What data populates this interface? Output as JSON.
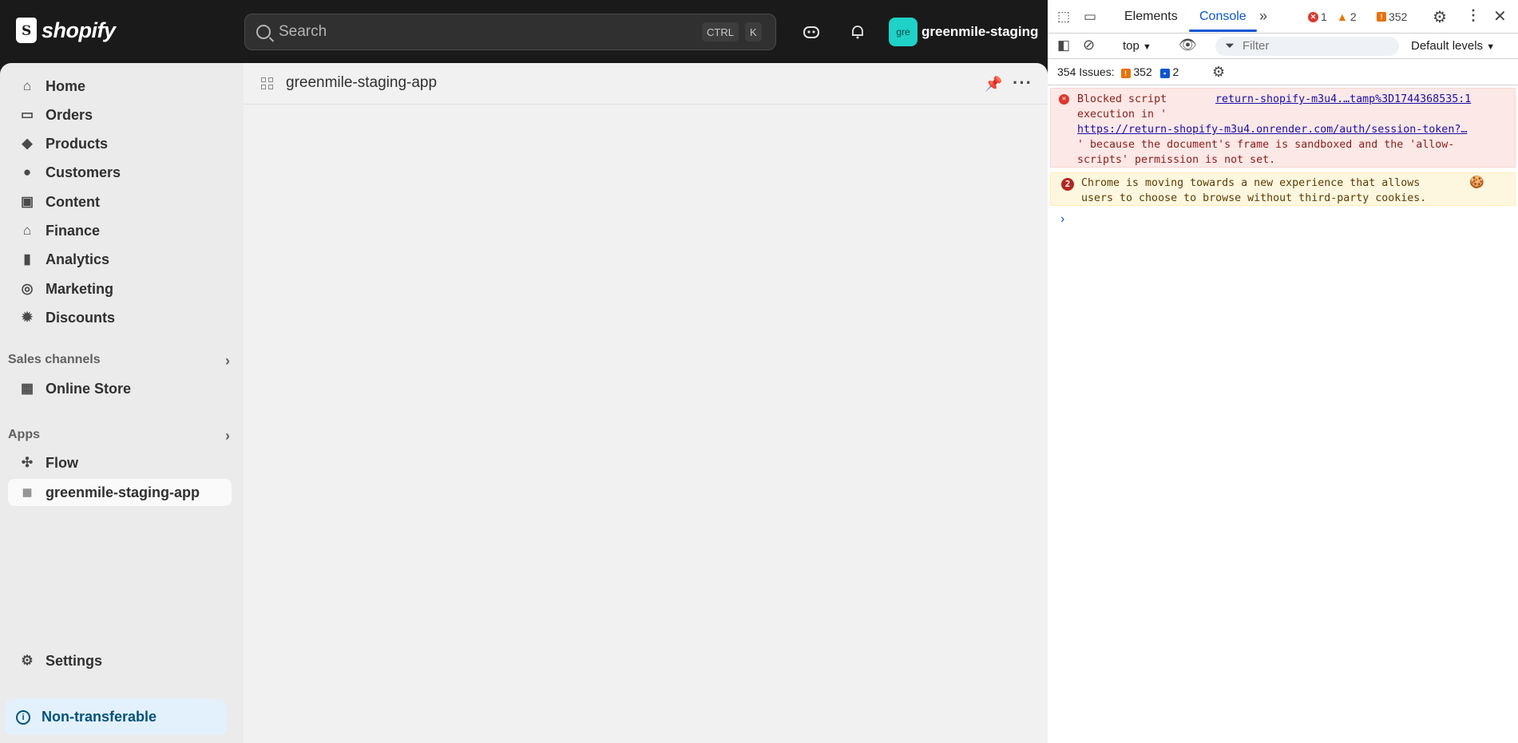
{
  "header": {
    "brand": "shopify",
    "search_placeholder": "Search",
    "shortcut_key1": "CTRL",
    "shortcut_key2": "K",
    "avatar_initials": "gre",
    "store_name": "greenmile-staging"
  },
  "sidebar": {
    "items": [
      {
        "label": "Home",
        "icon": "home-icon"
      },
      {
        "label": "Orders",
        "icon": "inbox-icon"
      },
      {
        "label": "Products",
        "icon": "tag-icon"
      },
      {
        "label": "Customers",
        "icon": "person-icon"
      },
      {
        "label": "Content",
        "icon": "image-icon"
      },
      {
        "label": "Finance",
        "icon": "bank-icon"
      },
      {
        "label": "Analytics",
        "icon": "bar-chart-icon"
      },
      {
        "label": "Marketing",
        "icon": "target-icon"
      },
      {
        "label": "Discounts",
        "icon": "discount-icon"
      }
    ],
    "sales_channels_label": "Sales channels",
    "online_store_label": "Online Store",
    "apps_label": "Apps",
    "flow_label": "Flow",
    "app_item_label": "greenmile-staging-app",
    "settings_label": "Settings",
    "non_transferable_label": "Non-transferable"
  },
  "main": {
    "app_title": "greenmile-staging-app"
  },
  "devtools": {
    "tabs": [
      "Elements",
      "Console"
    ],
    "error_count": "1",
    "warning_count": "2",
    "issue_count": "352",
    "context": "top",
    "filter_placeholder": "Filter",
    "levels": "Default levels",
    "issues_summary": "354 Issues:",
    "issues_orange": "352",
    "issues_blue": "2",
    "error_message": {
      "line1": "Blocked script",
      "source": "return-shopify-m3u4.…tamp%3D1744368535:1",
      "line2": "execution in '",
      "url": "https://return-shopify-m3u4.onrender.com/auth/session-token?…",
      "line3": "' because the document's frame is sandboxed and the 'allow-",
      "line4": "scripts' permission is not set."
    },
    "warning_message": {
      "count": "2",
      "line1": "Chrome is moving towards a new experience that allows",
      "line2": "users to choose to browse without third-party cookies."
    },
    "colors": {
      "accent": "#0b57d0",
      "error": "#dc362e",
      "warning": "#e37400"
    }
  }
}
